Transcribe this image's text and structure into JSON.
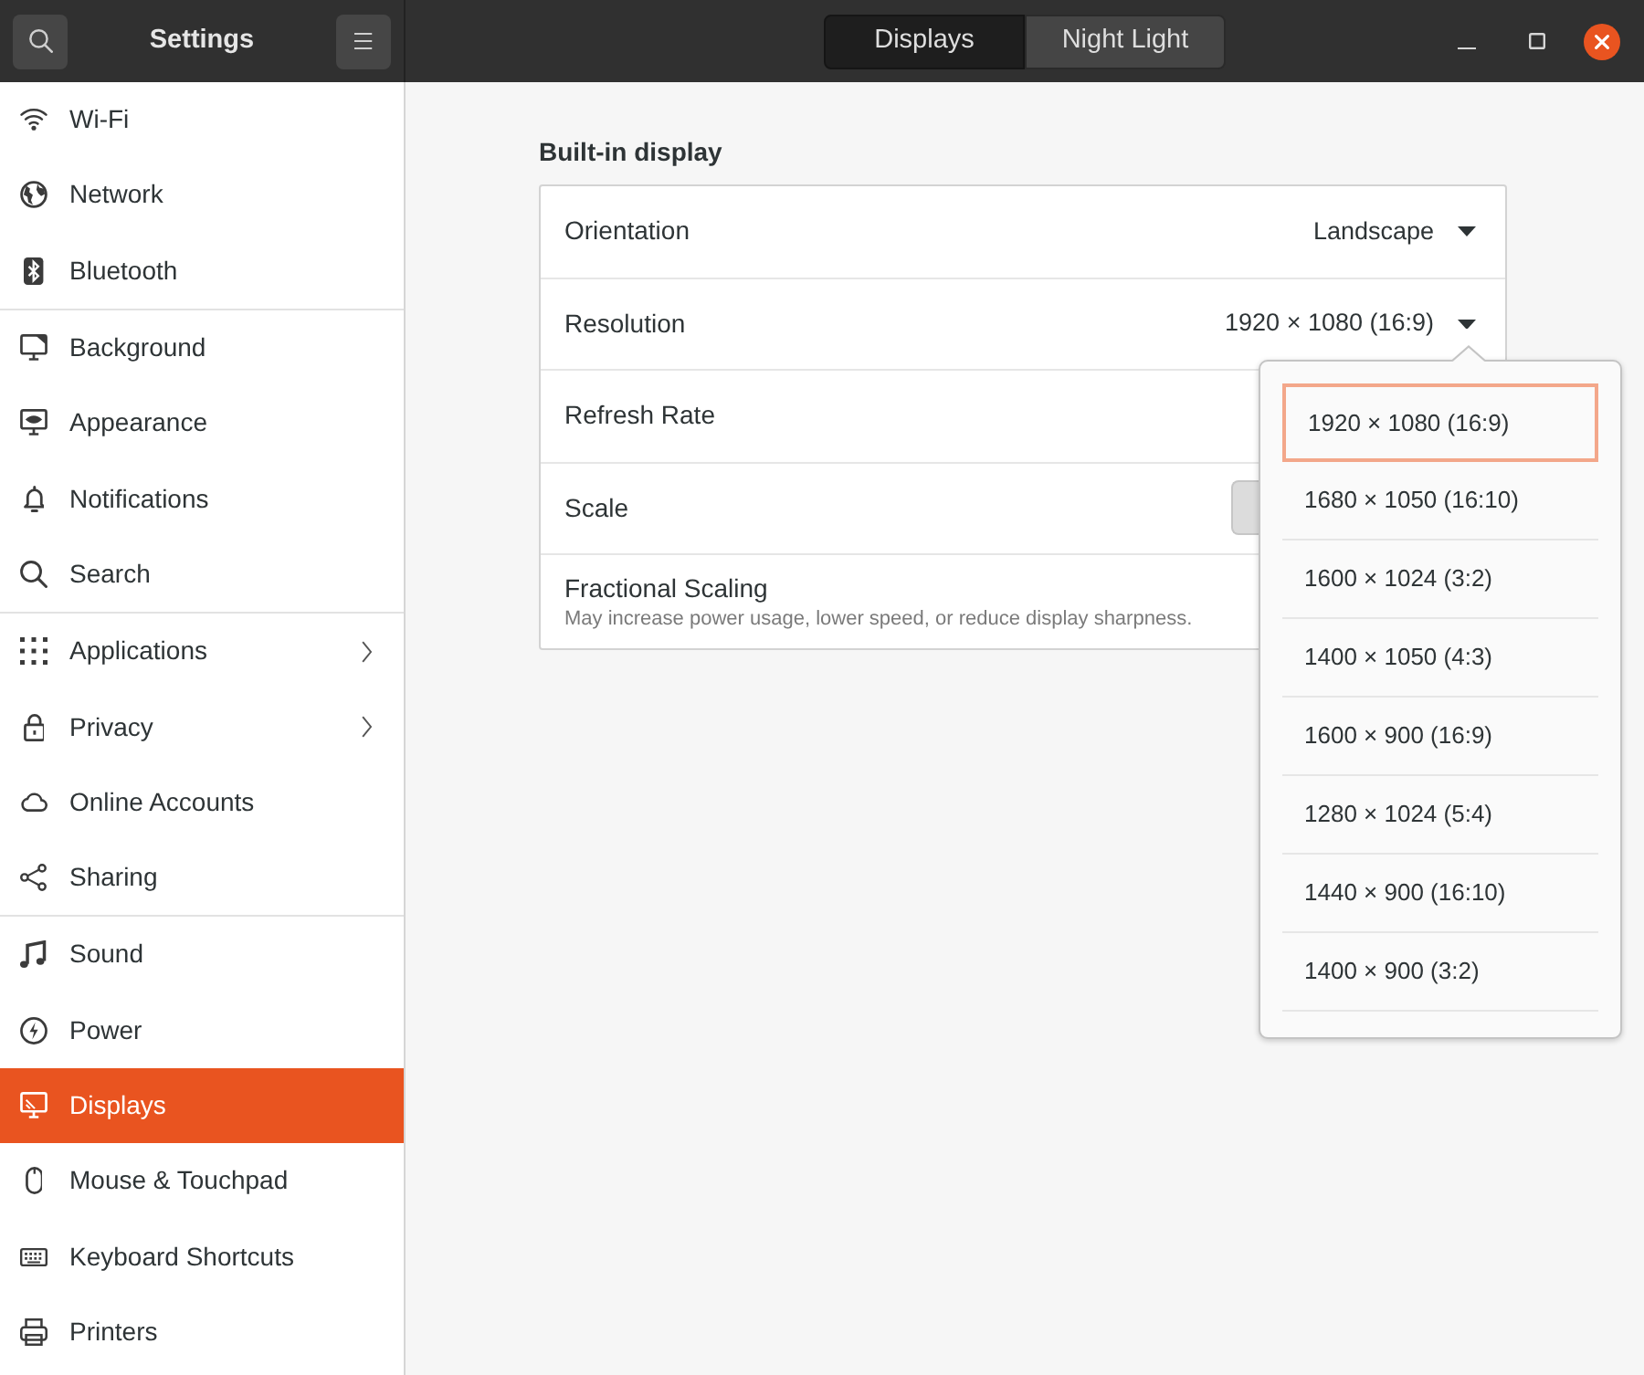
{
  "header": {
    "title": "Settings",
    "tabs": [
      {
        "label": "Displays",
        "selected": true
      },
      {
        "label": "Night Light",
        "selected": false
      }
    ]
  },
  "sidebar": {
    "groups": [
      {
        "items": [
          {
            "label": "Wi-Fi",
            "selected": false,
            "submenu": false
          },
          {
            "label": "Network",
            "selected": false,
            "submenu": false
          },
          {
            "label": "Bluetooth",
            "selected": false,
            "submenu": false
          }
        ]
      },
      {
        "items": [
          {
            "label": "Background",
            "selected": false,
            "submenu": false
          },
          {
            "label": "Appearance",
            "selected": false,
            "submenu": false
          },
          {
            "label": "Notifications",
            "selected": false,
            "submenu": false
          },
          {
            "label": "Search",
            "selected": false,
            "submenu": false
          }
        ]
      },
      {
        "items": [
          {
            "label": "Applications",
            "selected": false,
            "submenu": true
          },
          {
            "label": "Privacy",
            "selected": false,
            "submenu": true
          },
          {
            "label": "Online Accounts",
            "selected": false,
            "submenu": false
          },
          {
            "label": "Sharing",
            "selected": false,
            "submenu": false
          }
        ]
      },
      {
        "items": [
          {
            "label": "Sound",
            "selected": false,
            "submenu": false
          },
          {
            "label": "Power",
            "selected": false,
            "submenu": false
          },
          {
            "label": "Displays",
            "selected": true,
            "submenu": false
          },
          {
            "label": "Mouse & Touchpad",
            "selected": false,
            "submenu": false
          },
          {
            "label": "Keyboard Shortcuts",
            "selected": false,
            "submenu": false
          },
          {
            "label": "Printers",
            "selected": false,
            "submenu": false
          }
        ]
      }
    ]
  },
  "content": {
    "section_title": "Built-in display",
    "rows": [
      {
        "kind": "dropdown",
        "label": "Orientation",
        "value": "Landscape"
      },
      {
        "kind": "dropdown",
        "label": "Resolution",
        "value": "1920 × 1080 (16:9)",
        "menu": {
          "options": [
            {
              "label": "1920 × 1080 (16:9)",
              "selected": true
            },
            {
              "label": "1680 × 1050 (16:10)",
              "selected": false
            },
            {
              "label": "1600 × 1024 (3:2)",
              "selected": false
            },
            {
              "label": "1400 × 1050 (4:3)",
              "selected": false
            },
            {
              "label": "1600 × 900 (16:9)",
              "selected": false
            },
            {
              "label": "1280 × 1024 (5:4)",
              "selected": false
            },
            {
              "label": "1440 × 900 (16:10)",
              "selected": false
            },
            {
              "label": "1400 × 900 (3:2)",
              "selected": false
            }
          ]
        }
      },
      {
        "kind": "plain",
        "label": "Refresh Rate"
      },
      {
        "kind": "options",
        "label": "Scale"
      },
      {
        "kind": "plain",
        "label": "Fractional Scaling",
        "description": "May increase power usage, lower speed, or reduce display sharpness."
      }
    ]
  }
}
